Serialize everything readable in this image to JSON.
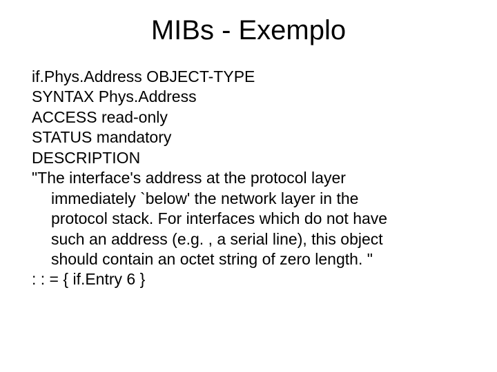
{
  "title": "MIBs - Exemplo",
  "lines": {
    "l1": "if.Phys.Address OBJECT-TYPE",
    "l2": "SYNTAX  Phys.Address",
    "l3": "ACCESS  read-only",
    "l4": "STATUS  mandatory",
    "l5": "DESCRIPTION",
    "l6": "\"The interface's address at the protocol layer",
    "l7": "immediately `below' the network layer in the",
    "l8": "protocol stack.  For interfaces which do not have",
    "l9": "such an address (e.g. , a serial line), this object",
    "l10": "should contain an octet string of zero length. \"",
    "l11": ": : = { if.Entry 6 }"
  }
}
